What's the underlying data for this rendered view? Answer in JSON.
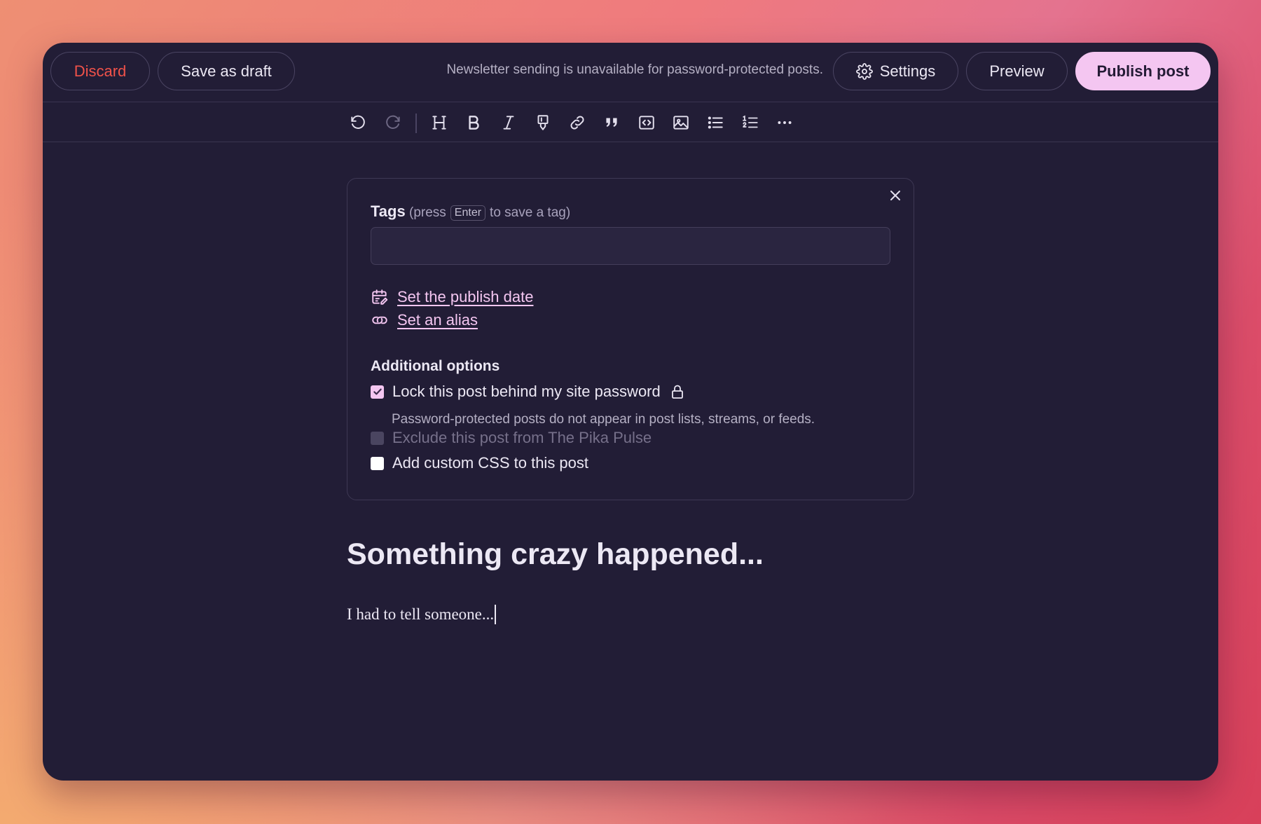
{
  "topbar": {
    "discard_label": "Discard",
    "draft_label": "Save as draft",
    "notice": "Newsletter sending is unavailable for password-protected posts.",
    "settings_label": "Settings",
    "preview_label": "Preview",
    "publish_label": "Publish post"
  },
  "toolbar": {
    "icons": [
      "undo-icon",
      "redo-icon",
      "heading-icon",
      "bold-icon",
      "italic-icon",
      "highlight-icon",
      "link-icon",
      "quote-icon",
      "code-block-icon",
      "image-icon",
      "bullet-list-icon",
      "numbered-list-icon",
      "more-icon"
    ]
  },
  "panel": {
    "tags_label": "Tags",
    "tags_hint_before": "(press",
    "tags_hint_key": "Enter",
    "tags_hint_after": "to save a tag)",
    "tags_input_value": "",
    "publish_date_link": "Set the publish date",
    "alias_link": "Set an alias",
    "additional_title": "Additional options",
    "options": [
      {
        "label": "Lock this post behind my site password",
        "checked": true,
        "disabled": false
      },
      {
        "label": "Exclude this post from The Pika Pulse",
        "checked": false,
        "disabled": true
      },
      {
        "label": "Add custom CSS to this post",
        "checked": false,
        "disabled": false
      }
    ],
    "lock_description": "Password-protected posts do not appear in post lists, streams, or feeds."
  },
  "post": {
    "title": "Something crazy happened...",
    "body": "I had to tell someone..."
  },
  "colors": {
    "accent": "#f4c6f1",
    "danger": "#f0524a",
    "window_bg": "#221d36"
  }
}
